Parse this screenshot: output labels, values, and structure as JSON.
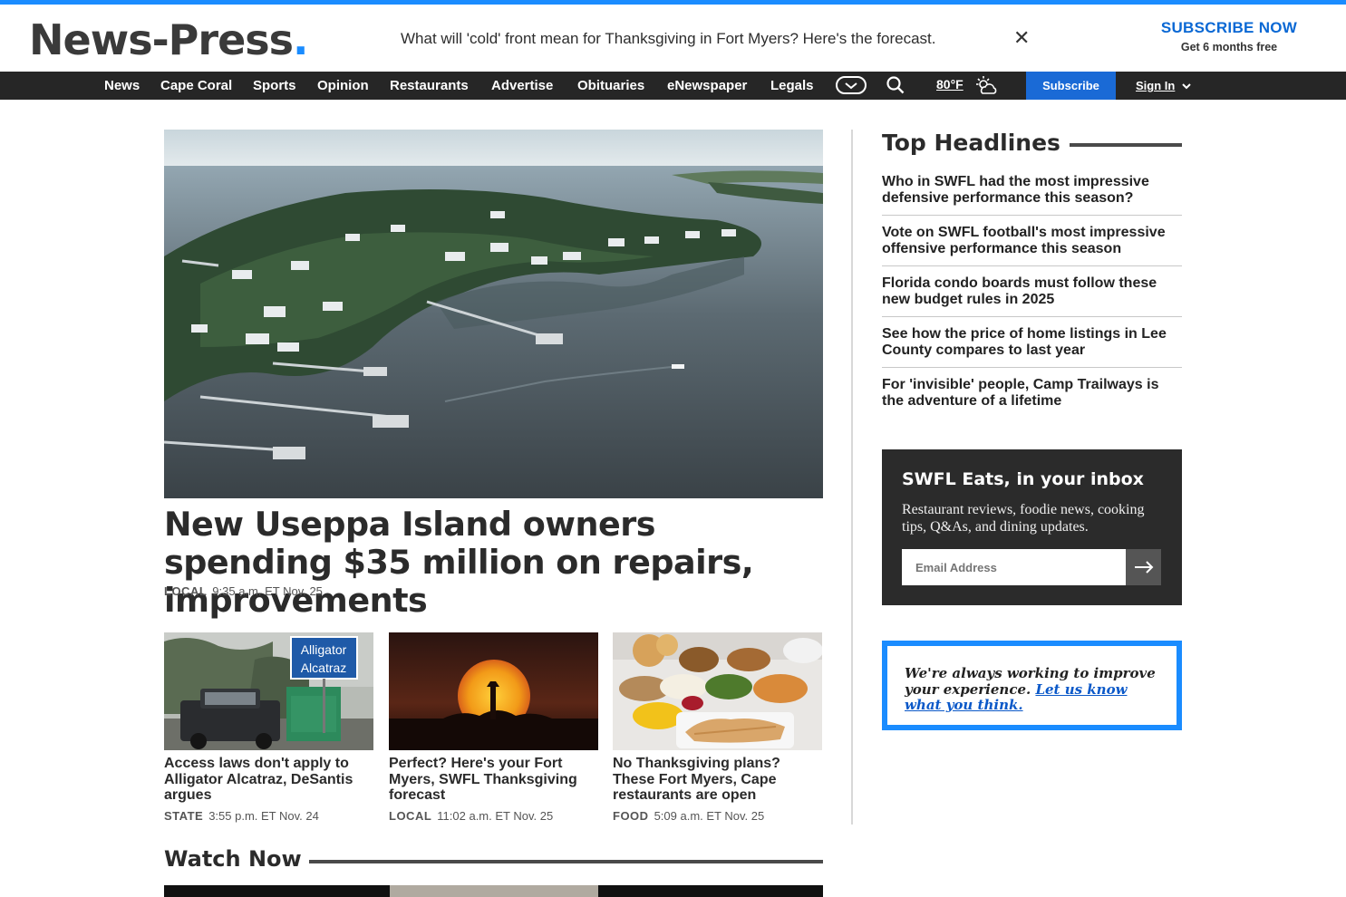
{
  "masthead": {
    "logo_text": "News-Press",
    "logo_dot": ".",
    "breaking_text": "What will 'cold' front mean for Thanksgiving in Fort Myers? Here's the forecast.",
    "close_glyph": "✕",
    "subscribe_line1": "SUBSCRIBE NOW",
    "subscribe_line2": "Get 6 months free"
  },
  "nav": {
    "items": [
      "News",
      "Cape Coral",
      "Sports",
      "Opinion",
      "Restaurants",
      "Advertise",
      "Obituaries",
      "eNewspaper",
      "Legals"
    ],
    "temperature": "80°F",
    "subscribe_label": "Subscribe",
    "signin_label": "Sign In",
    "icons": [
      "more-chevron-icon",
      "search-icon",
      "partly-sunny-icon",
      "chevron-down-icon"
    ]
  },
  "hero": {
    "title": "New Useppa Island owners spending $35 million on repairs, improvements",
    "category": "LOCAL",
    "time": "9:35 a.m. ET Nov. 25",
    "sign_text": ""
  },
  "cards": [
    {
      "title": "Access laws don't apply to Alligator Alcatraz, DeSantis argues",
      "category": "STATE",
      "time": "3:55 p.m. ET Nov. 24",
      "sign_line1": "Alligator",
      "sign_line2": "Alcatraz"
    },
    {
      "title": "Perfect? Here's your Fort Myers, SWFL Thanksgiving forecast",
      "category": "LOCAL",
      "time": "11:02 a.m. ET Nov. 25"
    },
    {
      "title": "No Thanksgiving plans? These Fort Myers, Cape restaurants are open",
      "category": "FOOD",
      "time": "5:09 a.m. ET Nov. 25"
    }
  ],
  "watch_now": {
    "label": "Watch Now"
  },
  "top_headlines": {
    "label": "Top Headlines",
    "items": [
      "Who in SWFL had the most impressive defensive performance this season?",
      "Vote on SWFL football's most impressive offensive performance this season",
      "Florida condo boards must follow these new budget rules in 2025",
      "See how the price of home listings in Lee County compares to last year",
      "For 'invisible' people, Camp Trailways is the adventure of a lifetime"
    ]
  },
  "newsletter": {
    "title": "SWFL Eats, in your inbox",
    "description": "Restaurant reviews, foodie news, cooking tips, Q&As, and dining updates.",
    "email_placeholder": "Email Address"
  },
  "feedback": {
    "text": "We're always working to improve your experience.",
    "link": "Let us know what you think."
  },
  "colors": {
    "accent": "#1a8cff",
    "nav_bg": "#262626",
    "subscribe_blue": "#1a6ad6",
    "newsletter_bg": "#2b2b2b"
  }
}
